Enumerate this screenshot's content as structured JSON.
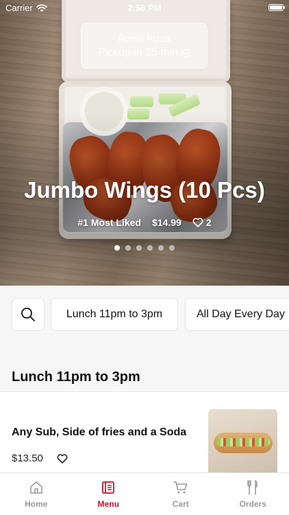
{
  "status_bar": {
    "carrier": "Carrier",
    "time": "2:58 PM"
  },
  "pickup": {
    "store_name": "Roma Pizza",
    "eta": "Pickup in 25 min"
  },
  "hero": {
    "title": "Jumbo Wings (10 Pcs)",
    "tag": "#1 Most Liked",
    "price": "$14.99",
    "likes": "2",
    "carousel_count": 6,
    "carousel_active": 0
  },
  "categories": {
    "items": [
      "Lunch 11pm to 3pm",
      "All Day Every Day"
    ]
  },
  "section": {
    "title": "Lunch 11pm to 3pm"
  },
  "menu_item": {
    "name": "Any Sub, Side of fries and a Soda",
    "price": "$13.50"
  },
  "tabbar": {
    "tabs": [
      {
        "label": "Home",
        "icon": "home-icon"
      },
      {
        "label": "Menu",
        "icon": "menu-icon"
      },
      {
        "label": "Cart",
        "icon": "cart-icon"
      },
      {
        "label": "Orders",
        "icon": "orders-icon"
      }
    ],
    "active_tab": "Menu"
  },
  "colors": {
    "accent": "#c8102e",
    "inactive": "#9a9a9a",
    "background": "#f6f6f6"
  }
}
